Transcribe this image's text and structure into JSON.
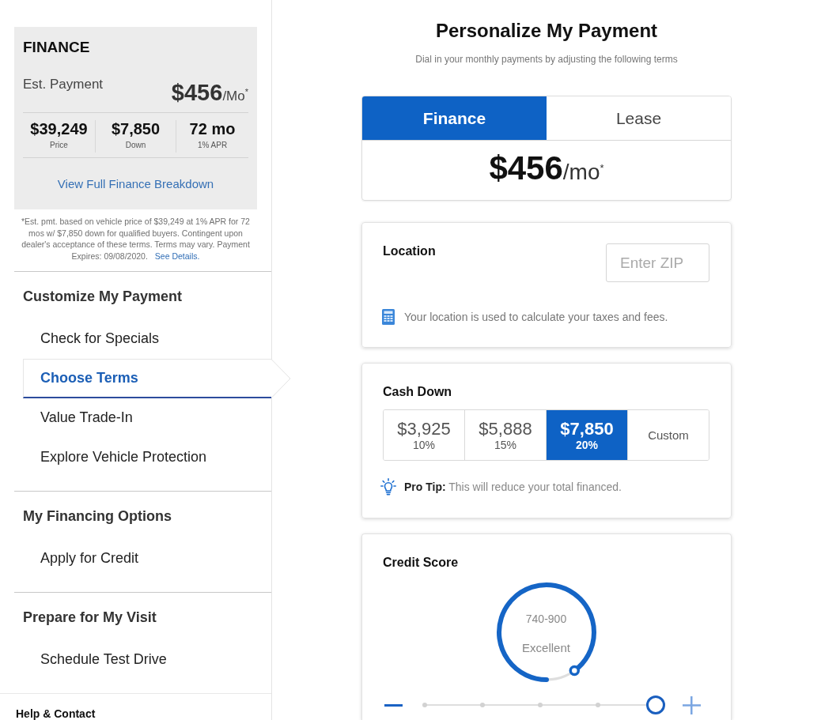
{
  "sidebar": {
    "summary": {
      "title": "FINANCE",
      "label": "Est. Payment",
      "payment": "**$456**/Mo$^{*}$",
      "stats": [
        {
          "value": "$39,249",
          "label": "Price"
        },
        {
          "value": "$7,850",
          "label": "Down"
        },
        {
          "value": "72 mo",
          "label": "1% APR"
        }
      ],
      "link": "View Full Finance Breakdown"
    },
    "disclaimer": {
      "text": "*Est. pmt. based on vehicle price of $39,249 at 1% APR for 72 mos w/ $7,850 down for qualified buyers. Contingent upon dealer's acceptance of these terms. Terms may vary. Payment Expires: 09/08/2020.",
      "link": "See Details."
    },
    "sections": [
      {
        "title": "Customize My Payment",
        "items": [
          {
            "label": "Check for Specials",
            "selected": false
          },
          {
            "label": "Choose Terms",
            "selected": true
          },
          {
            "label": "Value Trade-In",
            "selected": false
          },
          {
            "label": "Explore Vehicle Protection",
            "selected": false
          }
        ]
      },
      {
        "title": "My Financing Options",
        "items": [
          {
            "label": "Apply for Credit",
            "selected": false
          }
        ]
      },
      {
        "title": "Prepare for My Visit",
        "items": [
          {
            "label": "Schedule Test Drive",
            "selected": false
          }
        ]
      }
    ],
    "footer": "Help & Contact"
  },
  "main": {
    "title": "Personalize My Payment",
    "subtitle": "Dial in your monthly payments by adjusting the following terms",
    "payment_card": {
      "tabs": [
        {
          "label": "Finance",
          "selected": true
        },
        {
          "label": "Lease",
          "selected": false
        }
      ],
      "payment": "**$456**/mo$^{*}$"
    },
    "location": {
      "title": "Location",
      "zip": {
        "placeholder": "Enter ZIP"
      },
      "note": "Your location is used to calculate your taxes and fees."
    },
    "cash_down": {
      "title": "Cash Down",
      "options": [
        {
          "kind": "amount",
          "amount": "$3,925",
          "percent": "10%",
          "selected": false
        },
        {
          "kind": "amount",
          "amount": "$5,888",
          "percent": "15%",
          "selected": false
        },
        {
          "kind": "amount",
          "amount": "$7,850",
          "percent": "20%",
          "selected": true
        },
        {
          "kind": "custom",
          "label": "Custom",
          "selected": false
        }
      ],
      "tip": "**Pro Tip:** This will reduce your total financed."
    },
    "credit_score": {
      "title": "Credit Score",
      "gauge": {
        "range": "740-900",
        "rating": "Excellent",
        "level": 0.9
      },
      "slider": {
        "level": 1
      }
    }
  }
}
